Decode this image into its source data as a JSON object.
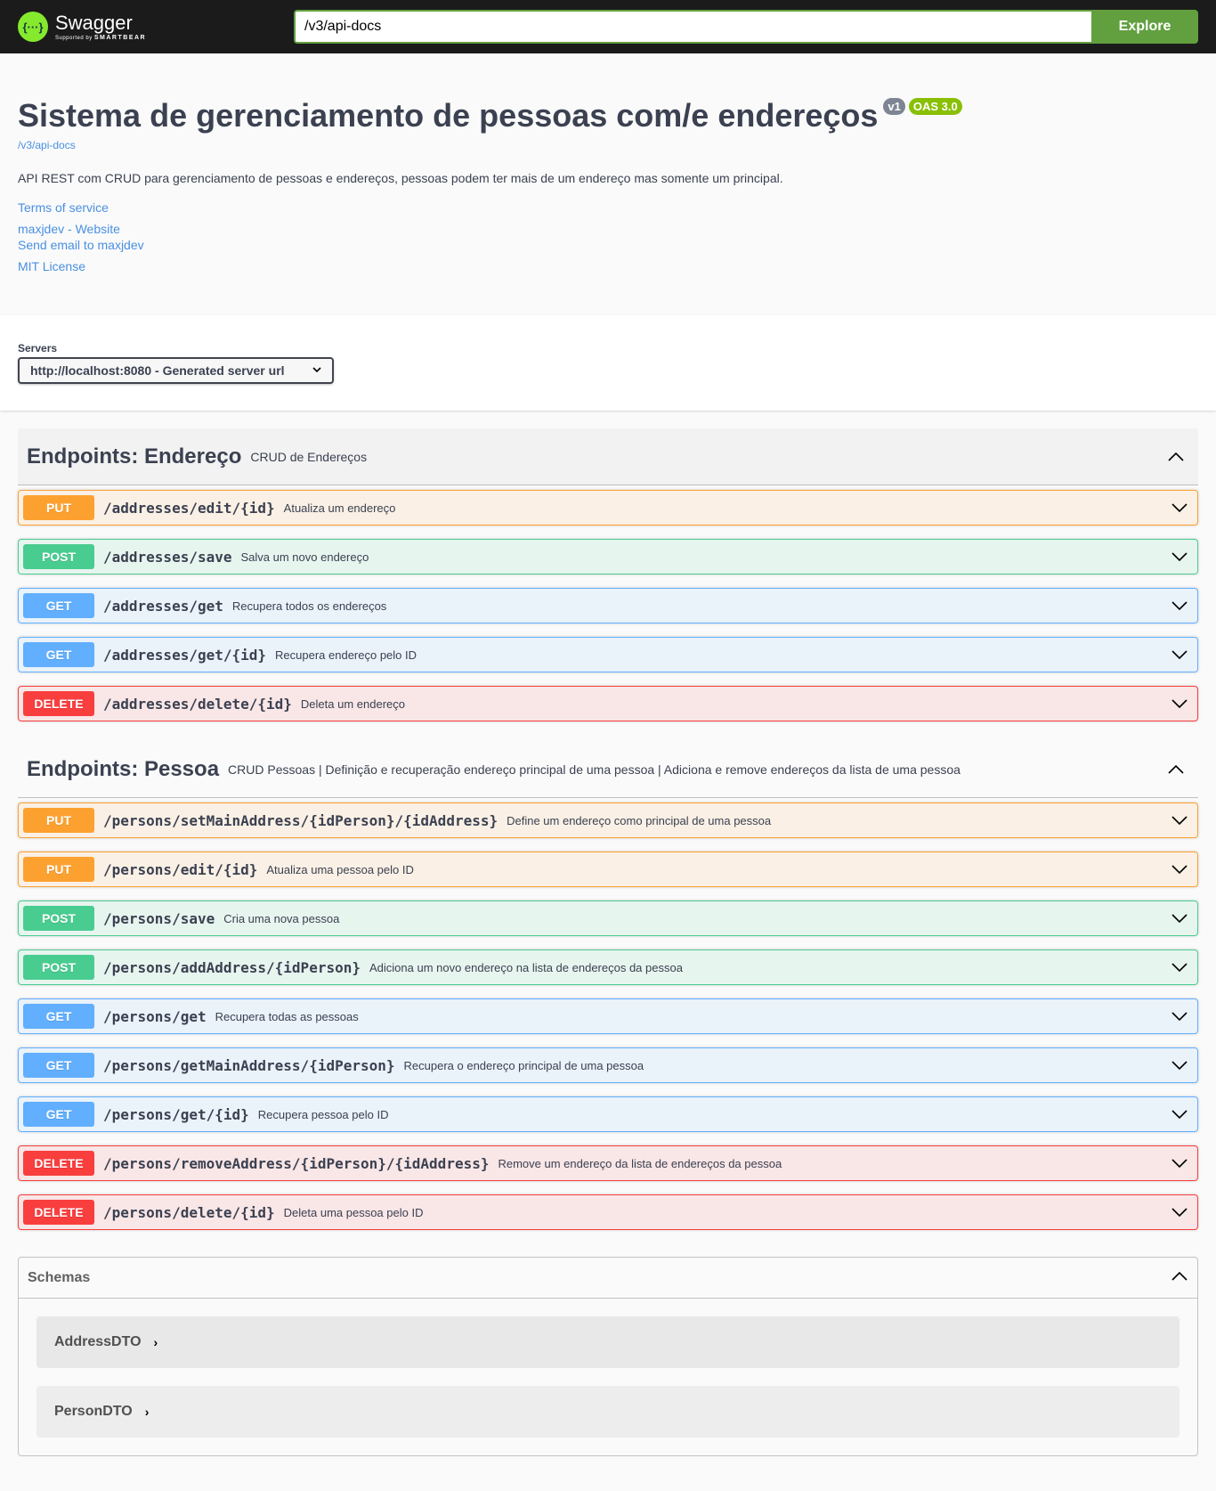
{
  "topbar": {
    "brand": "Swagger",
    "brand_sub_prefix": "Supported by",
    "brand_sub_company": "SMARTBEAR",
    "url_value": "/v3/api-docs",
    "explore_label": "Explore"
  },
  "info": {
    "title": "Sistema de gerenciamento de pessoas com/e endereços",
    "version_badge": "v1",
    "oas_badge": "OAS 3.0",
    "spec_link": "/v3/api-docs",
    "description": "API REST com CRUD para gerenciamento de pessoas e endereços, pessoas podem ter mais de um endereço mas somente um principal.",
    "terms": "Terms of service",
    "website": "maxjdev - Website",
    "email": "Send email to maxjdev",
    "license": "MIT License"
  },
  "servers": {
    "label": "Servers",
    "selected": "http://localhost:8080 - Generated server url"
  },
  "tags": [
    {
      "name": "Endpoints: Endereço",
      "description": "CRUD de Endereços",
      "operations": [
        {
          "method": "PUT",
          "path": "/addresses/edit/{id}",
          "summary": "Atualiza um endereço"
        },
        {
          "method": "POST",
          "path": "/addresses/save",
          "summary": "Salva um novo endereço"
        },
        {
          "method": "GET",
          "path": "/addresses/get",
          "summary": "Recupera todos os endereços"
        },
        {
          "method": "GET",
          "path": "/addresses/get/{id}",
          "summary": "Recupera endereço pelo ID"
        },
        {
          "method": "DELETE",
          "path": "/addresses/delete/{id}",
          "summary": "Deleta um endereço"
        }
      ]
    },
    {
      "name": "Endpoints: Pessoa",
      "description": "CRUD Pessoas | Definição e recuperação endereço principal de uma pessoa | Adiciona e remove endereços da lista de uma pessoa",
      "operations": [
        {
          "method": "PUT",
          "path": "/persons/setMainAddress/{idPerson}/{idAddress}",
          "summary": "Define um endereço como principal de uma pessoa"
        },
        {
          "method": "PUT",
          "path": "/persons/edit/{id}",
          "summary": "Atualiza uma pessoa pelo ID"
        },
        {
          "method": "POST",
          "path": "/persons/save",
          "summary": "Cria uma nova pessoa"
        },
        {
          "method": "POST",
          "path": "/persons/addAddress/{idPerson}",
          "summary": "Adiciona um novo endereço na lista de endereços da pessoa"
        },
        {
          "method": "GET",
          "path": "/persons/get",
          "summary": "Recupera todas as pessoas"
        },
        {
          "method": "GET",
          "path": "/persons/getMainAddress/{idPerson}",
          "summary": "Recupera o endereço principal de uma pessoa"
        },
        {
          "method": "GET",
          "path": "/persons/get/{id}",
          "summary": "Recupera pessoa pelo ID"
        },
        {
          "method": "DELETE",
          "path": "/persons/removeAddress/{idPerson}/{idAddress}",
          "summary": "Remove um endereço da lista de endereços da pessoa"
        },
        {
          "method": "DELETE",
          "path": "/persons/delete/{id}",
          "summary": "Deleta uma pessoa pelo ID"
        }
      ]
    }
  ],
  "schemas": {
    "title": "Schemas",
    "items": [
      "AddressDTO",
      "PersonDTO"
    ]
  },
  "colors": {
    "put": "#fca130",
    "post": "#49cc90",
    "get": "#61affe",
    "delete": "#f93e3e",
    "brand": "#85ea2d",
    "explore": "#62a03f",
    "link": "#4990e2"
  }
}
